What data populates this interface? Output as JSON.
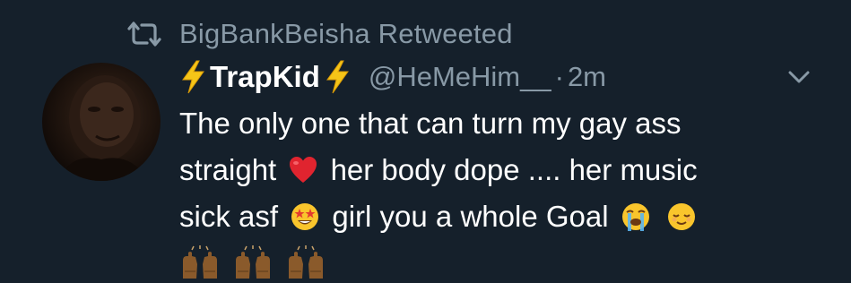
{
  "retweet": {
    "icon": "retweet-icon",
    "text": "BigBankBeisha Retweeted"
  },
  "tweet": {
    "avatar_icon": "profile-photo",
    "display_name": "TrapKid",
    "name_icons": [
      "lightning-bolt-icon",
      "lightning-bolt-icon"
    ],
    "handle": "@HeMeHim__",
    "separator": "·",
    "time": "2m",
    "menu_icon": "chevron-down-icon",
    "text_lines": [
      "The only one that can turn my gay ass",
      "straight",
      "her body dope .... her music",
      "sick asf",
      "girl you a whole Goal"
    ],
    "emojis": [
      "red-heart",
      "star-struck",
      "loudly-crying-face",
      "relieved-face",
      "raising-hands",
      "raising-hands",
      "raising-hands"
    ]
  },
  "colors": {
    "background": "#15202b",
    "primary_text": "#ffffff",
    "secondary_text": "#8899a6",
    "bolt": "#f5c518"
  }
}
